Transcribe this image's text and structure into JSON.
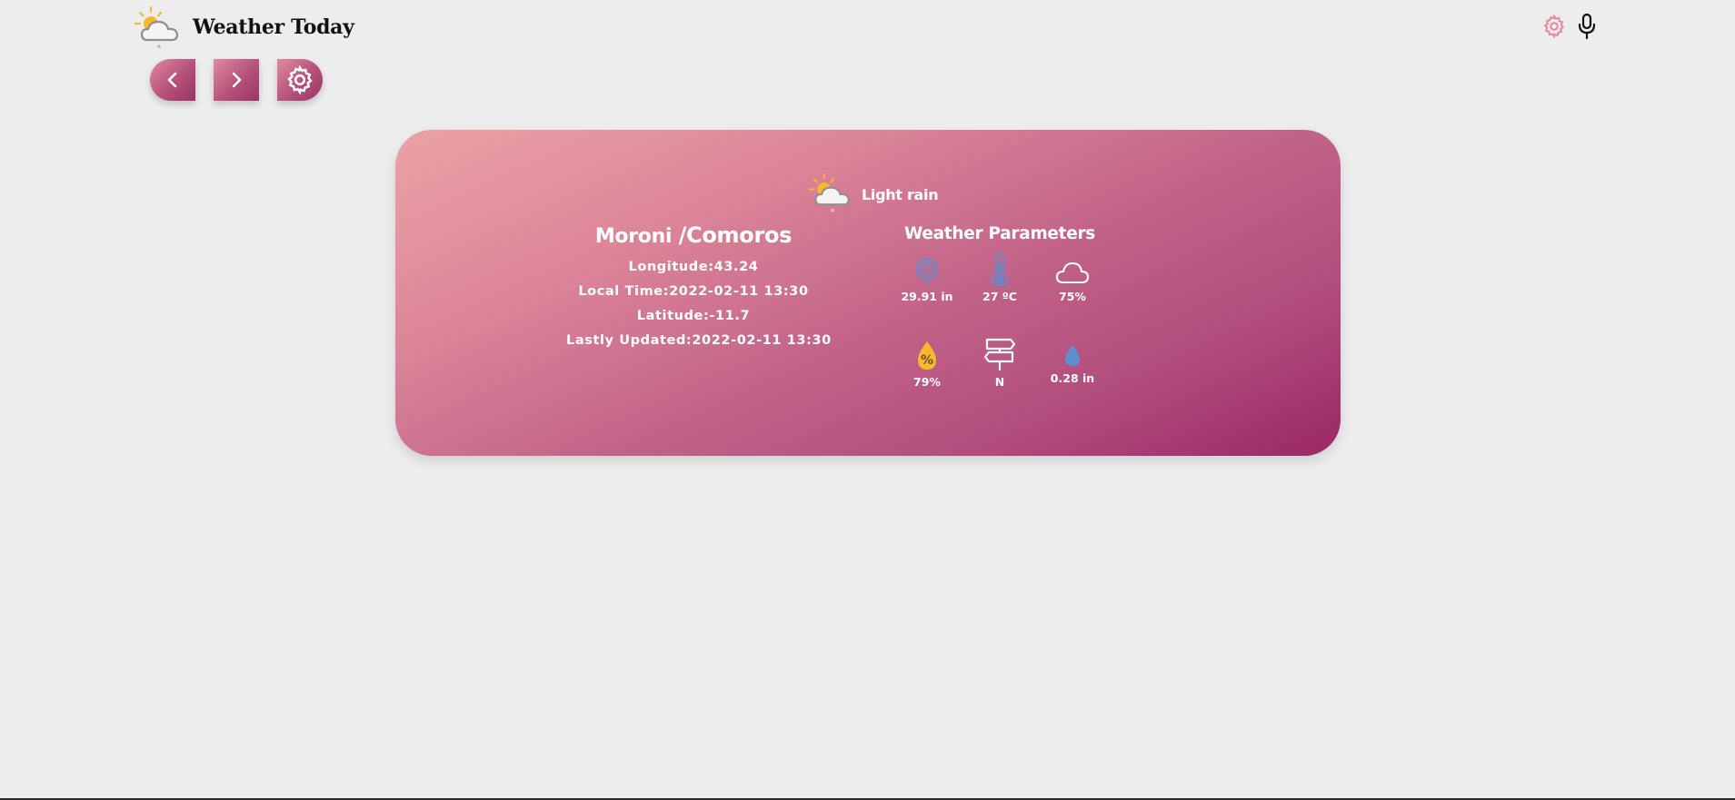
{
  "app": {
    "title": "Weather Today"
  },
  "header": {
    "icons": [
      "weather-logo-icon",
      "gear-icon",
      "microphone-icon"
    ]
  },
  "nav": {
    "buttons": [
      "chevron-left-icon",
      "chevron-right-icon",
      "gear-icon"
    ]
  },
  "card": {
    "condition": "Light rain",
    "city": "Moroni",
    "country": "/Comoros",
    "longitude": "Longitude:43.24",
    "local_time": "Local Time:2022-02-11 13:30",
    "latitude": "Latitude:-11.7",
    "last_updated": "Lastly Updated:2022-02-11 13:30"
  },
  "parameters": {
    "title": "Weather Parameters",
    "items": [
      {
        "icon": "pressure-gauge-icon",
        "value": "29.91 in"
      },
      {
        "icon": "thermometer-icon",
        "value": "27 ºC"
      },
      {
        "icon": "cloud-icon",
        "value": "75%"
      },
      {
        "icon": "humidity-drop-icon",
        "value": "79%"
      },
      {
        "icon": "wind-direction-signpost-icon",
        "value": "N"
      },
      {
        "icon": "precipitation-drop-icon",
        "value": "0.28 in"
      }
    ]
  },
  "colors": {
    "background": "#ededed",
    "card_gradient_start": "#eba2a6",
    "card_gradient_end": "#9a2764",
    "accent_pink": "#e8899c",
    "icon_blue": "#5b8fd0",
    "icon_yellow": "#f5b92e"
  }
}
